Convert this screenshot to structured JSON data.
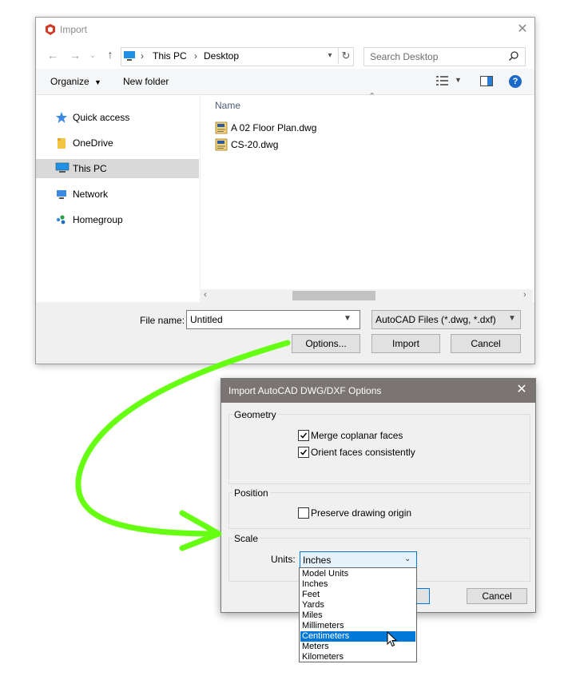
{
  "import_dialog": {
    "title": "Import",
    "address": {
      "crumbs": [
        "This PC",
        "Desktop"
      ]
    },
    "search_placeholder": "Search Desktop",
    "toolbar": {
      "organize": "Organize",
      "new_folder": "New folder"
    },
    "nav": [
      {
        "label": "Quick access",
        "icon": "star-icon"
      },
      {
        "label": "OneDrive",
        "icon": "folder-icon"
      },
      {
        "label": "This PC",
        "icon": "computer-icon",
        "selected": true
      },
      {
        "label": "Network",
        "icon": "network-icon"
      },
      {
        "label": "Homegroup",
        "icon": "homegroup-icon"
      }
    ],
    "column_name": "Name",
    "files": [
      "A 02 Floor Plan.dwg",
      "CS-20.dwg"
    ],
    "file_name_label": "File name:",
    "file_name_value": "Untitled",
    "file_type": "AutoCAD Files (*.dwg, *.dxf)",
    "buttons": {
      "options": "Options...",
      "import": "Import",
      "cancel": "Cancel"
    }
  },
  "options_dialog": {
    "title": "Import AutoCAD DWG/DXF Options",
    "geometry": {
      "title": "Geometry",
      "merge_label": "Merge coplanar faces",
      "merge_checked": true,
      "orient_label": "Orient faces consistently",
      "orient_checked": true
    },
    "position": {
      "title": "Position",
      "preserve_label": "Preserve drawing origin",
      "preserve_checked": false
    },
    "scale": {
      "title": "Scale",
      "units_label": "Units:",
      "units_value": "Inches",
      "options": [
        "Model Units",
        "Inches",
        "Feet",
        "Yards",
        "Miles",
        "Millimeters",
        "Centimeters",
        "Meters",
        "Kilometers"
      ],
      "highlighted": "Centimeters"
    },
    "cancel": "Cancel"
  },
  "colors": {
    "accent": "#0078d7",
    "arrow": "#66ff11",
    "options_titlebar": "#7a7472"
  }
}
